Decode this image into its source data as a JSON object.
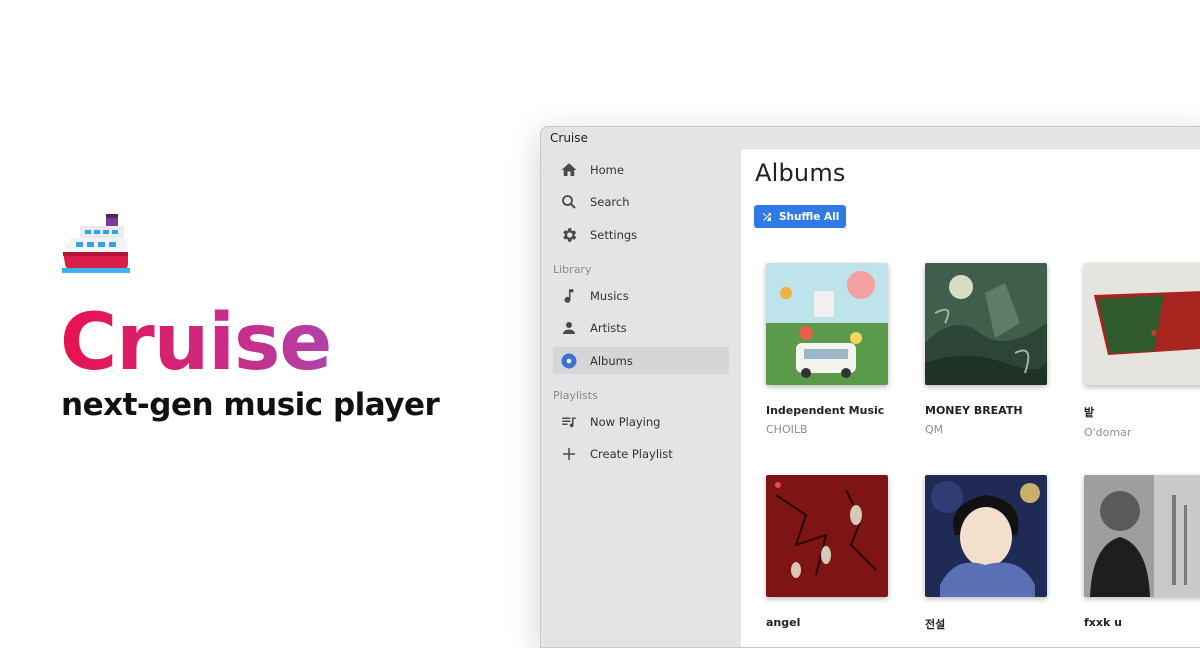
{
  "hero": {
    "title": "Cruise",
    "tagline": "next-gen music player",
    "logo_icon": "cruise-ship-icon"
  },
  "window": {
    "title": "Cruise"
  },
  "sidebar": {
    "items": [
      {
        "label": "Home",
        "icon": "home-icon"
      },
      {
        "label": "Search",
        "icon": "search-icon"
      },
      {
        "label": "Settings",
        "icon": "gear-icon"
      }
    ],
    "library_label": "Library",
    "library_items": [
      {
        "label": "Musics",
        "icon": "music-note-icon"
      },
      {
        "label": "Artists",
        "icon": "person-icon"
      },
      {
        "label": "Albums",
        "icon": "album-disc-icon",
        "active": true
      }
    ],
    "playlists_label": "Playlists",
    "playlist_items": [
      {
        "label": "Now Playing",
        "icon": "queue-music-icon"
      },
      {
        "label": "Create Playlist",
        "icon": "plus-icon"
      }
    ]
  },
  "main": {
    "title": "Albums",
    "shuffle_label": "Shuffle All",
    "albums": [
      {
        "title": "Independent Music",
        "artist": "CHOILB"
      },
      {
        "title": "MONEY BREATH",
        "artist": "QM"
      },
      {
        "title": "밭",
        "artist": "O'domar"
      },
      {
        "title": "angel",
        "artist": ""
      },
      {
        "title": "전설",
        "artist": ""
      },
      {
        "title": "fxxk u",
        "artist": ""
      }
    ]
  },
  "colors": {
    "brand_gradient_start": "#e8124f",
    "brand_gradient_end": "#b042a8",
    "accent": "#2f7ae5",
    "active_nav": "#3a6fd8"
  }
}
